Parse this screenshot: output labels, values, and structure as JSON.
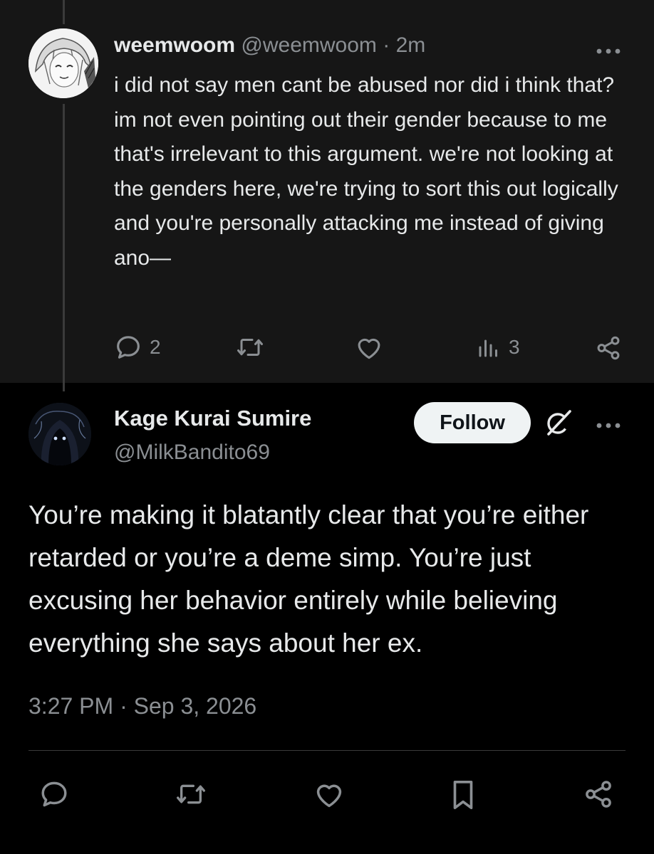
{
  "parent_tweet": {
    "display_name": "weemwoom",
    "handle": "@weemwoom",
    "separator": " · ",
    "time_ago": "2m",
    "text": "i did not say men cant be abused nor did i think that? im not even pointing out their gender because to me that's irrelevant to this argument. we're not looking at the genders here, we're trying to sort this out logically and you're personally attacking me instead of giving ano—",
    "replies_count": "2",
    "views_count": "3",
    "more_icon": "more-horizontal-icon"
  },
  "main_tweet": {
    "display_name": "Kage Kurai Sumire",
    "handle": "@MilkBandito69",
    "follow_label": "Follow",
    "text": "You’re making it blatantly clear that you’re either retarded or you’re a deme simp. You’re just excusing her behavior entirely while believing everything she says about her ex.",
    "timestamp": "3:27 PM · Sep 3, 2026",
    "more_icon": "more-horizontal-icon"
  },
  "colors": {
    "background": "#000000",
    "parent_background": "#161616",
    "text_primary": "#e7e9ea",
    "text_secondary": "#8b8f93",
    "follow_bg": "#eff3f4"
  }
}
